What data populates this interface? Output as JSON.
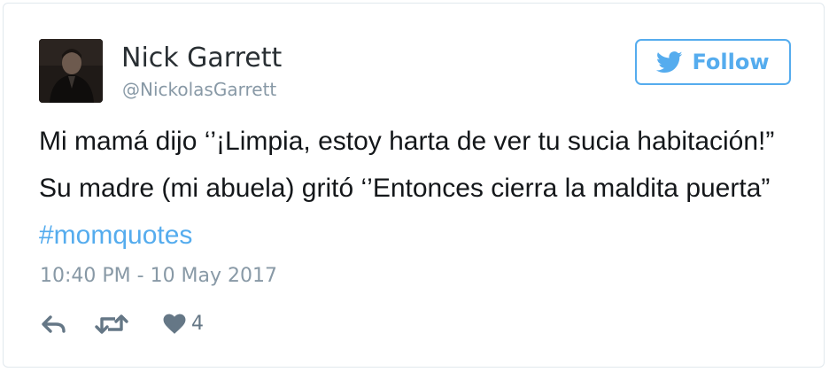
{
  "author": {
    "name": "Nick Garrett",
    "handle": "@NickolasGarrett"
  },
  "follow_button": {
    "label": "Follow",
    "icon": "twitter-bird-icon"
  },
  "tweet": {
    "lines": [
      "Mi mamá dijo ‘’¡Limpia, estoy harta de ver tu sucia habitación!”",
      "Su madre (mi abuela) gritó ‘’Entonces cierra la maldita puerta”"
    ],
    "hashtag": "#momquotes",
    "timestamp": "10:40 PM - 10 May 2017"
  },
  "actions": {
    "reply_icon": "reply-icon",
    "retweet_icon": "retweet-icon",
    "like_icon": "heart-icon",
    "like_count": "4"
  },
  "colors": {
    "accent": "#55acee",
    "text": "#14171a",
    "muted": "#8899a6",
    "border": "#e1e8ed"
  }
}
